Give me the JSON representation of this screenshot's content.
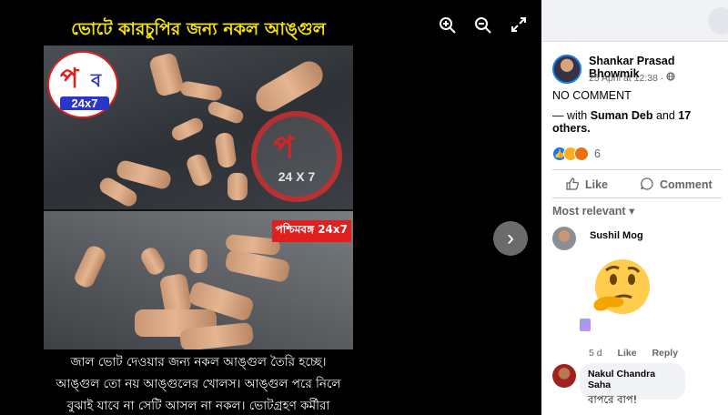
{
  "viewer": {
    "title": "ভোটে কারচুপির জন্য নকল আঙ্গুল",
    "caption_lines": [
      "জাল ভোট দেওয়ার জন্য নকল আঙ্গুল তৈরি হচ্ছে।",
      "আঙ্গুল তো নয় আঙ্গুলের খোলস। আঙ্গুল পরে নিলে",
      "বুঝাই যাবে না সেটি আসল না নকল। ভোটগ্রহণ কর্মীরা"
    ],
    "logo_letter": "প",
    "logo_letter2": "ব",
    "logo_text": "24x7",
    "watermark_text": "24 X 7",
    "badge_text": "পশ্চিমবঙ্গ 24x7",
    "controls": {
      "zoom_in_icon": "zoom-in-icon",
      "zoom_out_icon": "zoom-out-icon",
      "fullscreen_icon": "fullscreen-icon",
      "next_icon": "chevron-right-icon"
    }
  },
  "post": {
    "author": "Shankar Prasad Bhowmik",
    "date": "25 April at 12:38",
    "audience_icon": "globe-icon",
    "text": "NO COMMENT",
    "with_prefix": "— with",
    "with_name": "Suman Deb",
    "with_and": "and",
    "with_others": "17 others.",
    "reaction_count": "6",
    "reaction_icons": [
      "like-reaction-icon",
      "wow-reaction-icon",
      "angry-reaction-icon"
    ],
    "actions": {
      "like": "Like",
      "comment": "Comment"
    },
    "sort_label": "Most relevant"
  },
  "comments": [
    {
      "name": "Sushil Mog",
      "sticker": "thinking-face-sticker",
      "time": "5 d",
      "like": "Like",
      "reply": "Reply"
    },
    {
      "name": "Nakul Chandra Saha",
      "text": "বাপরে বাপ!"
    }
  ],
  "colors": {
    "accent": "#1877f2",
    "title_yellow": "#f6e600",
    "logo_red": "#e02020",
    "logo_blue": "#2b35c9"
  }
}
